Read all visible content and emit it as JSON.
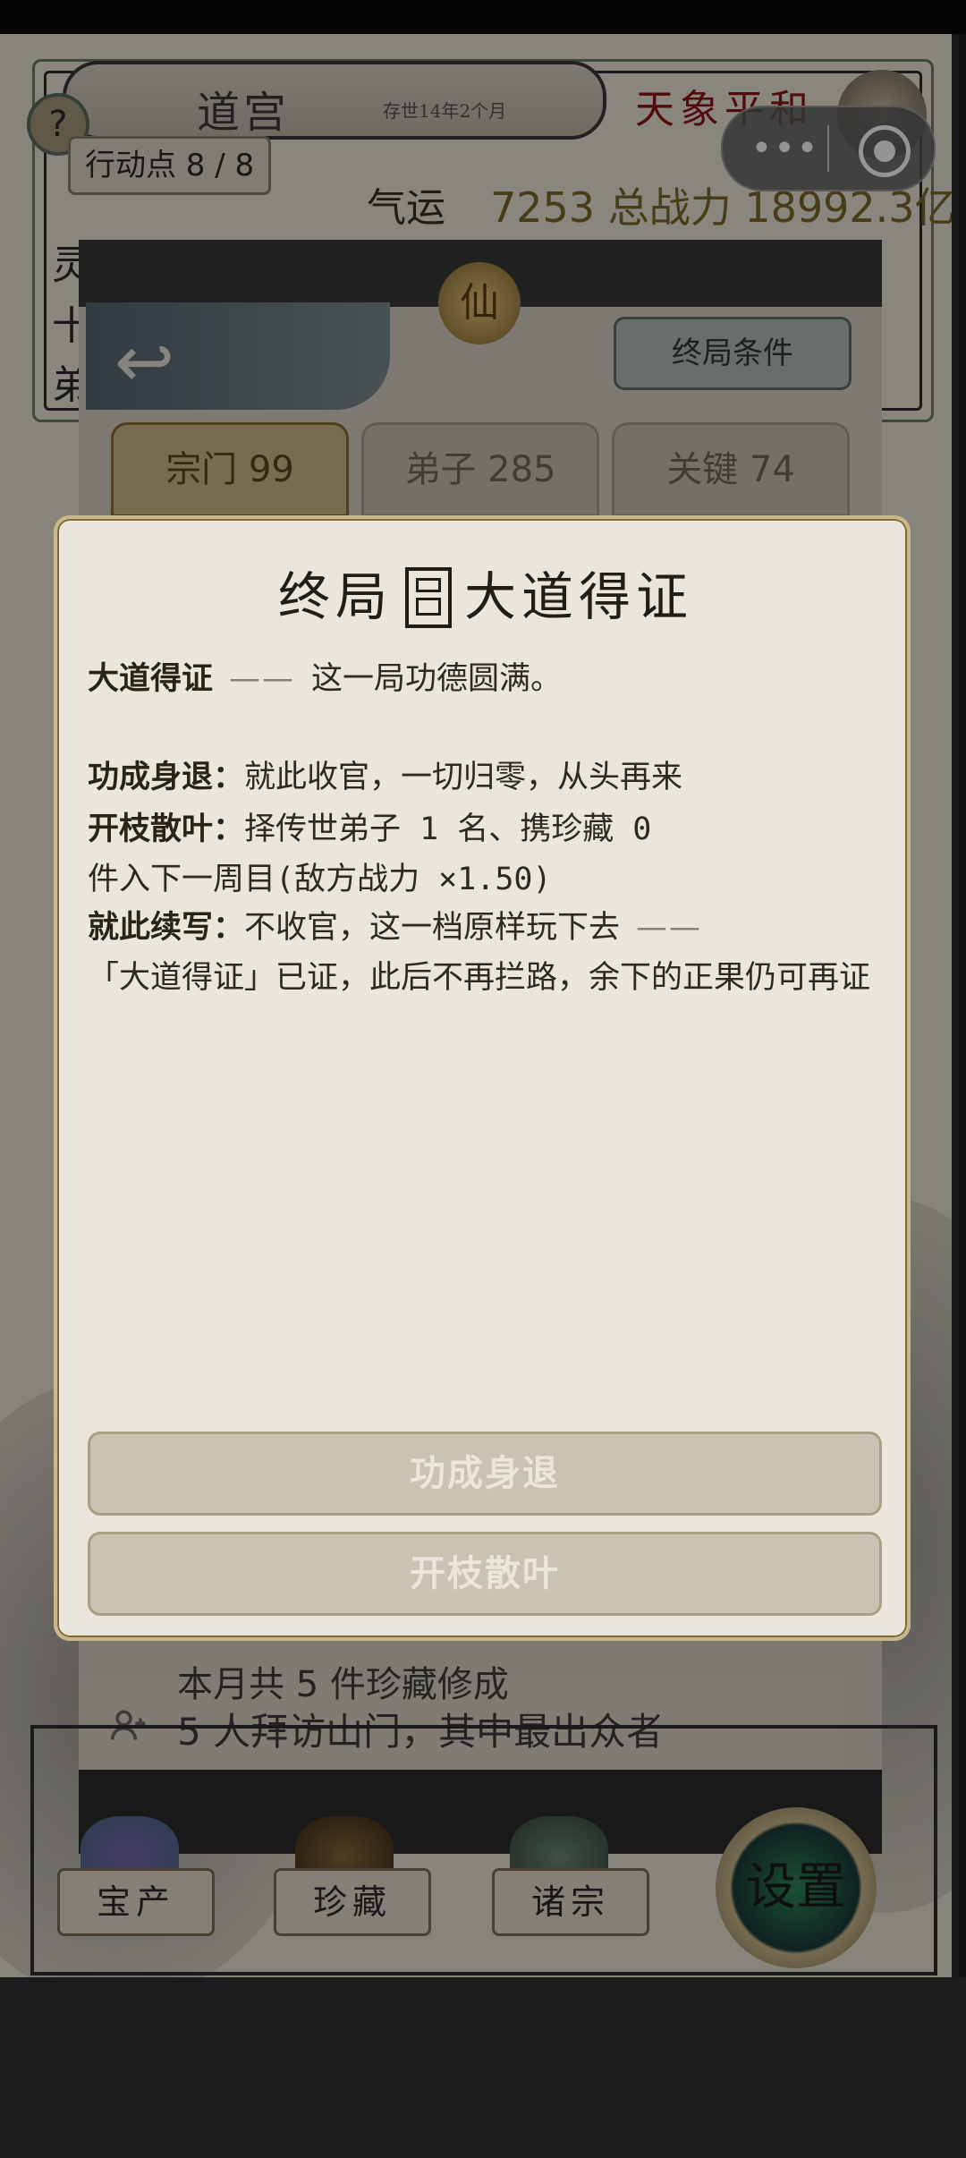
{
  "header": {
    "title": "道宫",
    "subtitle": "存世14年2个月",
    "weather": "天象平和",
    "action_points": "行动点 8 / 8",
    "luck_label": "气运",
    "power_text": "7253 总战力 18992.3亿",
    "side_chars": [
      "灵",
      "十",
      "弟"
    ]
  },
  "capsule": {
    "more": "•••"
  },
  "panel": {
    "emblem": "仙",
    "end_condition_button": "终局条件",
    "tabs": [
      {
        "label": "宗门 99",
        "active": true
      },
      {
        "label": "弟子 285",
        "active": false
      },
      {
        "label": "关键 74",
        "active": false
      }
    ],
    "log_rows": [
      "本月共 5 件珍藏修成",
      "5 人拜访山门，其中最出众者"
    ]
  },
  "nav": {
    "items": [
      "宝产",
      "珍藏",
      "诸宗"
    ],
    "settings": "设置"
  },
  "modal": {
    "title_left": "终局",
    "title_right": "大道得证",
    "line1": {
      "label": "大道得证",
      "dash": "——",
      "text": "这一局功德圆满。"
    },
    "line2": {
      "label": "功成身退：",
      "text": "就此收官，一切归零，从头再来"
    },
    "line3": {
      "label": "开枝散叶：",
      "text": "择传世弟子 1 名、携珍藏 0"
    },
    "line4": {
      "text": "件入下一周目(敌方战力 ×1.50)"
    },
    "line5": {
      "label": "就此续写：",
      "text": "不收官，这一档原样玩下去",
      "dash": "——"
    },
    "line6": {
      "text": "「大道得证」已证，此后不再拦路，余下的正果仍可再证"
    },
    "buttons": [
      "功成身退",
      "开枝散叶"
    ]
  }
}
